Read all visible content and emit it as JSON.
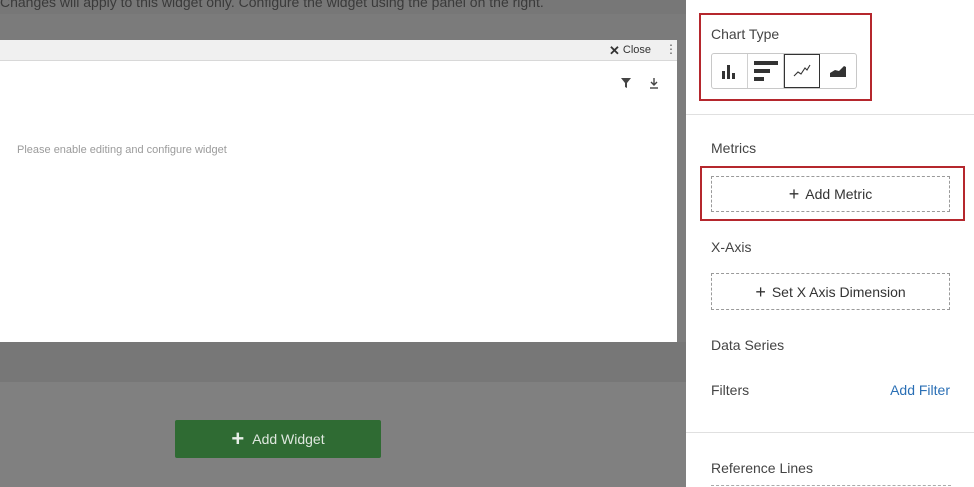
{
  "workspace": {
    "top_hint": "Changes will apply to this widget only. Configure the widget using the panel on the right."
  },
  "widget": {
    "close_label": "Close",
    "kebab": "⋮",
    "empty_message": "Please enable editing and configure widget",
    "tools": [
      "filter-icon",
      "download-icon"
    ]
  },
  "add_widget": {
    "label": "Add Widget"
  },
  "panel": {
    "chart_type_label": "Chart Type",
    "chart_types": [
      "bar-chart-icon",
      "horizontal-bar-chart-icon",
      "line-chart-icon",
      "area-chart-icon"
    ],
    "selected_chart_type": "line-chart-icon",
    "metrics_label": "Metrics",
    "add_metric": "Add Metric",
    "x_axis_label": "X-Axis",
    "set_x_axis": "Set X Axis Dimension",
    "data_series_label": "Data Series",
    "filters_label": "Filters",
    "add_filter": "Add Filter",
    "reference_lines_label": "Reference Lines"
  },
  "colors": {
    "highlight": "#b5272d",
    "add_widget_bg": "#2f6b33",
    "link": "#2a6fb5"
  }
}
